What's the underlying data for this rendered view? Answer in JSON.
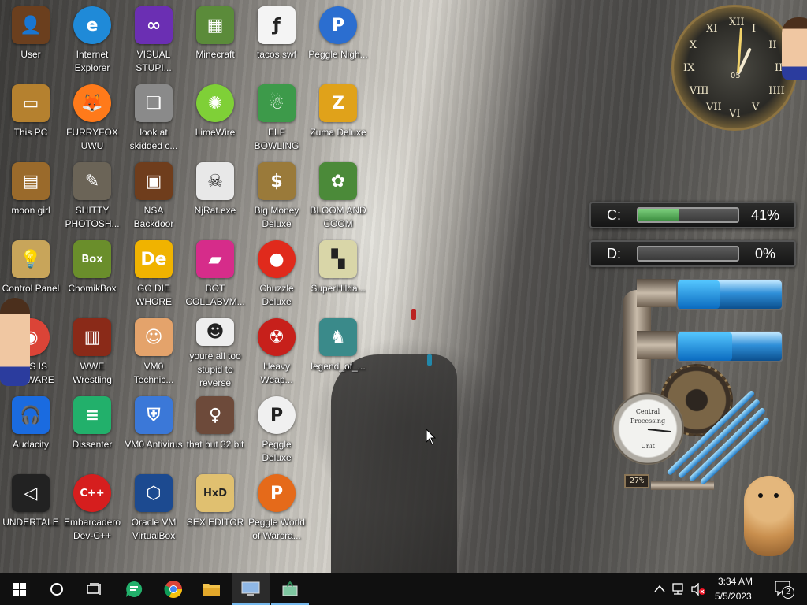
{
  "desktop_icons": [
    {
      "label": "User",
      "icon": "folder-user-icon",
      "color": "#6b3f1e"
    },
    {
      "label": "Internet Explorer",
      "icon": "edge-browser-icon",
      "color": "#1f8ad8"
    },
    {
      "label": "VISUAL STUPI...",
      "icon": "visual-studio-icon",
      "color": "#6b2fb3"
    },
    {
      "label": "Minecraft",
      "icon": "minecraft-grass-icon",
      "color": "#5b8b3a"
    },
    {
      "label": "tacos.swf",
      "icon": "flash-file-icon",
      "color": "#f4f4f4"
    },
    {
      "label": "Peggle Nigh...",
      "icon": "peggle-icon",
      "color": "#2b6ed0"
    },
    {
      "label": "This PC",
      "icon": "computer-icon",
      "color": "#b5812f"
    },
    {
      "label": "FURRYFOX UWU",
      "icon": "firefox-icon",
      "color": "#ff7a1a"
    },
    {
      "label": "look at skidded c...",
      "icon": "copies-icon",
      "color": "#8a8a8a"
    },
    {
      "label": "LimeWire",
      "icon": "limewire-icon",
      "color": "#7fd037"
    },
    {
      "label": "ELF BOWLING",
      "icon": "elf-bowling-icon",
      "color": "#3d9a4a"
    },
    {
      "label": "Zuma Deluxe",
      "icon": "zuma-icon",
      "color": "#e0a21a"
    },
    {
      "label": "moon girl",
      "icon": "book-folder-icon",
      "color": "#9a6a2b"
    },
    {
      "label": "SHITTY PHOTOSH...",
      "icon": "gimp-icon",
      "color": "#6b6457"
    },
    {
      "label": "NSA Backdoor",
      "icon": "picture-frame-icon",
      "color": "#6f3d1c"
    },
    {
      "label": "NjRat.exe",
      "icon": "skull-icon",
      "color": "#e8e8e8"
    },
    {
      "label": "Big Money Deluxe",
      "icon": "money-bag-icon",
      "color": "#9a7a3a"
    },
    {
      "label": "BLOOM AND COOM",
      "icon": "flower-icon",
      "color": "#4b8a39"
    },
    {
      "label": "Control Panel",
      "icon": "light-bulb-icon",
      "color": "#c8a55a"
    },
    {
      "label": "ChomikBox",
      "icon": "hamster-box-icon",
      "color": "#6a8e2b"
    },
    {
      "label": "GO DIE WHORE",
      "icon": "de-app-icon",
      "color": "#f0b300"
    },
    {
      "label": "BOT COLLABVM...",
      "icon": "monitor-gradient-icon",
      "color": "#d62c8a"
    },
    {
      "label": "Chuzzle Deluxe",
      "icon": "chuzzle-icon",
      "color": "#e02a1c"
    },
    {
      "label": "SuperHilda...",
      "icon": "pixel-cat-icon",
      "color": "#d9d6a8"
    },
    {
      "label": "THIS IS SPYWARE",
      "icon": "chrome-icon",
      "color": "#db4437"
    },
    {
      "label": "WWE Wrestling",
      "icon": "tv-icon",
      "color": "#8a2a18"
    },
    {
      "label": "VM0 Technic...",
      "icon": "support-person-icon",
      "color": "#e4a36b"
    },
    {
      "label": "youre all too stupid to reverse engineer shit",
      "icon": "portrait-sketch-icon",
      "color": "#eeeeee"
    },
    {
      "label": "Heavy Weap...",
      "icon": "radiation-icon",
      "color": "#c7201b"
    },
    {
      "label": "legend_of_...",
      "icon": "pixel-hero-icon",
      "color": "#3a8a8a"
    },
    {
      "label": "Audacity",
      "icon": "headphones-icon",
      "color": "#1a6be0"
    },
    {
      "label": "Dissenter",
      "icon": "chat-bubble-icon",
      "color": "#22b06b"
    },
    {
      "label": "VM0 Antivirus",
      "icon": "shield-icon",
      "color": "#3b78d8"
    },
    {
      "label": "that but 32 bit",
      "icon": "portrait-icon",
      "color": "#6d4a3a"
    },
    {
      "label": "Peggle Deluxe",
      "icon": "peggle-icon",
      "color": "#f0f0f0"
    },
    {
      "label": "",
      "icon": "",
      "color": ""
    },
    {
      "label": "UNDERTALE",
      "icon": "unity-icon",
      "color": "#222222"
    },
    {
      "label": "Embarcadero Dev-C++",
      "icon": "devcpp-icon",
      "color": "#d61e1e"
    },
    {
      "label": "Oracle VM VirtualBox",
      "icon": "virtualbox-cube-icon",
      "color": "#1c4a90"
    },
    {
      "label": "SEX EDITOR",
      "icon": "hxd-icon",
      "color": "#e0c070"
    },
    {
      "label": "Peggle World of Warcra...",
      "icon": "peggle-icon",
      "color": "#e56a1a"
    },
    {
      "label": "",
      "icon": "",
      "color": ""
    }
  ],
  "icon_glyphs": {
    "User": "👤",
    "Internet Explorer": "e",
    "VISUAL STUPI...": "∞",
    "Minecraft": "▦",
    "tacos.swf": "ƒ",
    "Peggle Nigh...": "P",
    "This PC": "▭",
    "FURRYFOX UWU": "🦊",
    "look at skidded c...": "❏",
    "LimeWire": "✺",
    "ELF BOWLING": "☃",
    "Zuma Deluxe": "Z",
    "moon girl": "▤",
    "SHITTY PHOTOSH...": "✎",
    "NSA Backdoor": "▣",
    "NjRat.exe": "☠",
    "Big Money Deluxe": "$",
    "BLOOM AND COOM": "✿",
    "Control Panel": "💡",
    "ChomikBox": "Box",
    "GO DIE WHORE": "De",
    "BOT COLLABVM...": "▰",
    "Chuzzle Deluxe": "●",
    "SuperHilda...": "▚",
    "THIS IS SPYWARE": "◉",
    "WWE Wrestling": "▥",
    "VM0 Technic...": "☺",
    "youre all too stupid to reverse engineer shit": "☻",
    "Heavy Weap...": "☢",
    "legend_of_...": "♞",
    "Audacity": "🎧",
    "Dissenter": "≡",
    "VM0 Antivirus": "⛨",
    "that but 32 bit": "♀",
    "Peggle Deluxe": "P",
    "UNDERTALE": "◁",
    "Embarcadero Dev-C++": "C++",
    "Oracle VM VirtualBox": "⬡",
    "SEX EDITOR": "HxD",
    "Peggle World of Warcra...": "P"
  },
  "clock": {
    "numerals": [
      "XII",
      "I",
      "II",
      "III",
      "IIII",
      "V",
      "VI",
      "VII",
      "VIII",
      "IX",
      "X",
      "XI"
    ],
    "date_window": "05"
  },
  "drives": [
    {
      "letter": "C:",
      "percent_text": "41%",
      "fill": 0.41
    },
    {
      "letter": "D:",
      "percent_text": "0%",
      "fill": 0.0
    }
  ],
  "steam_gauge": {
    "dial_top_text": "Central",
    "dial_mid_text": "Processing",
    "dial_bottom_text": "Unit",
    "readout": "27%",
    "tube_fill_1": 0.4,
    "tube_fill_2": 0.52
  },
  "taskbar": {
    "items": [
      {
        "name": "start-button",
        "icon": "windows-logo-icon",
        "active": false
      },
      {
        "name": "search-button",
        "icon": "search-circle-icon",
        "active": false
      },
      {
        "name": "task-view-button",
        "icon": "task-view-icon",
        "active": false
      },
      {
        "name": "taskbar-dissenter",
        "icon": "chat-bubble-icon",
        "active": false
      },
      {
        "name": "taskbar-chrome",
        "icon": "chrome-icon",
        "active": false
      },
      {
        "name": "taskbar-file-explorer",
        "icon": "folder-icon",
        "active": false
      },
      {
        "name": "taskbar-remote-desktop",
        "icon": "remote-desktop-icon",
        "active": true
      },
      {
        "name": "taskbar-app",
        "icon": "network-pc-icon",
        "active": true
      }
    ],
    "time": "3:34 AM",
    "date": "5/5/2023",
    "notification_count": "2",
    "accent": "#76b9ed"
  }
}
